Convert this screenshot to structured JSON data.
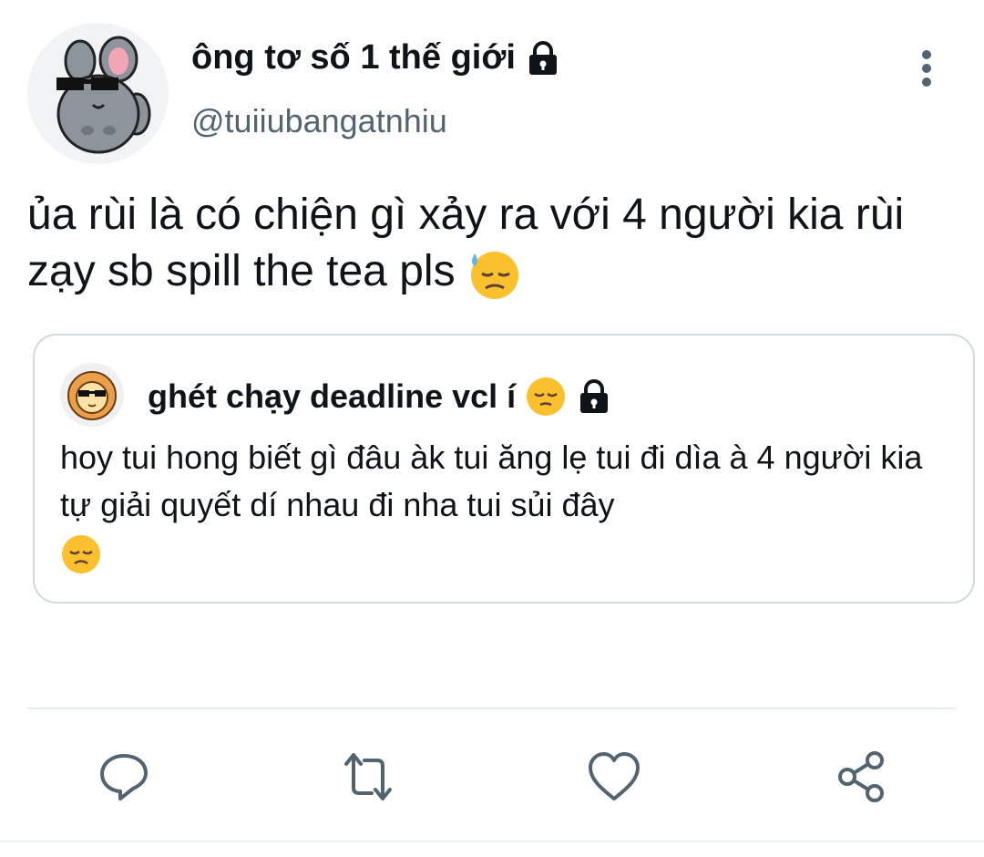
{
  "tweet": {
    "display_name": "ông tơ số 1 thế giới",
    "handle": "@tuiiubangatnhiu",
    "text": "ủa rùi là có chiện gì xảy ra với 4 người kia rùi zạy sb spill the tea pls",
    "text_emoji": "downcast-face-with-sweat-emoji",
    "avatar_icon": "chinchilla-sunglasses-avatar",
    "lock_icon": "lock-icon"
  },
  "quote": {
    "display_name": "ghét chạy deadline vcl í",
    "name_emoji": "pensive-face-emoji",
    "text": "hoy tui hong biết gì đâu àk tui ăng lẹ tui đi dìa à 4 người kia tự giải quyết dí nhau đi nha tui sủi đây",
    "text_emoji": "disappointed-face-emoji",
    "avatar_icon": "lion-sunglasses-avatar"
  },
  "actions": [
    "reply-icon",
    "retweet-icon",
    "like-icon",
    "share-icon"
  ],
  "colors": {
    "text": "#0f1419",
    "secondary": "#536471",
    "icon": "#536471",
    "border": "#cfd9de",
    "emoji": "#fbc02d"
  }
}
